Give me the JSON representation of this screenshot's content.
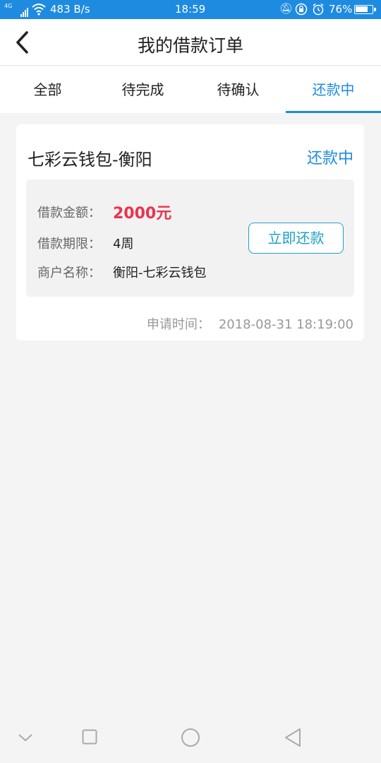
{
  "status_bar": {
    "network": "4G",
    "speed": "483 B/s",
    "time": "18:59",
    "battery_pct": "76%",
    "battery_level": 0.76,
    "icons": [
      "signal-icon",
      "wifi-icon",
      "notification-muted-icon",
      "rotation-lock-icon",
      "alarm-icon",
      "battery-icon"
    ]
  },
  "header": {
    "title": "我的借款订单",
    "back_icon": "chevron-left-icon"
  },
  "tabs": [
    {
      "label": "全部",
      "active": false
    },
    {
      "label": "待完成",
      "active": false
    },
    {
      "label": "待确认",
      "active": false
    },
    {
      "label": "还款中",
      "active": true
    }
  ],
  "order": {
    "title": "七彩云钱包-衡阳",
    "status": "还款中",
    "amount_label": "借款金额：",
    "amount_value": "2000元",
    "term_label": "借款期限：",
    "term_value": "4周",
    "merchant_label": "商户名称：",
    "merchant_value": "衡阳-七彩云钱包",
    "repay_button": "立即还款",
    "apply_time_label": "申请时间：",
    "apply_time_value": "2018-08-31 18:19:00"
  },
  "colors": {
    "accent": "#1e8be0",
    "amount": "#e9334f",
    "button": "#1ea0c8"
  },
  "nav_bar": {
    "icons": [
      "chevron-down-icon",
      "square-icon",
      "circle-icon",
      "triangle-back-icon"
    ]
  }
}
